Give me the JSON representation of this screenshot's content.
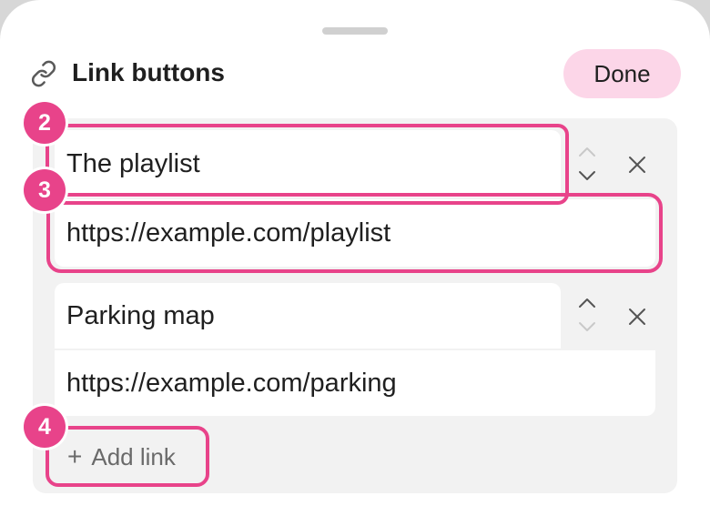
{
  "header": {
    "title": "Link buttons",
    "done_label": "Done"
  },
  "icons": {
    "link": "link-icon",
    "move_up": "chevron-up-icon",
    "move_down": "chevron-down-icon",
    "remove": "close-icon",
    "add": "plus-icon"
  },
  "links": [
    {
      "title": "The playlist",
      "url": "https://example.com/playlist"
    },
    {
      "title": "Parking map",
      "url": "https://example.com/parking"
    }
  ],
  "add_link_label": "Add link",
  "annotations": [
    "2",
    "3",
    "4"
  ],
  "colors": {
    "accent": "#e8438a",
    "done_button_bg": "#fcd6e8",
    "panel_bg": "#f2f2f2",
    "text": "#1f1f1f",
    "muted_text": "#6a6a6a"
  }
}
